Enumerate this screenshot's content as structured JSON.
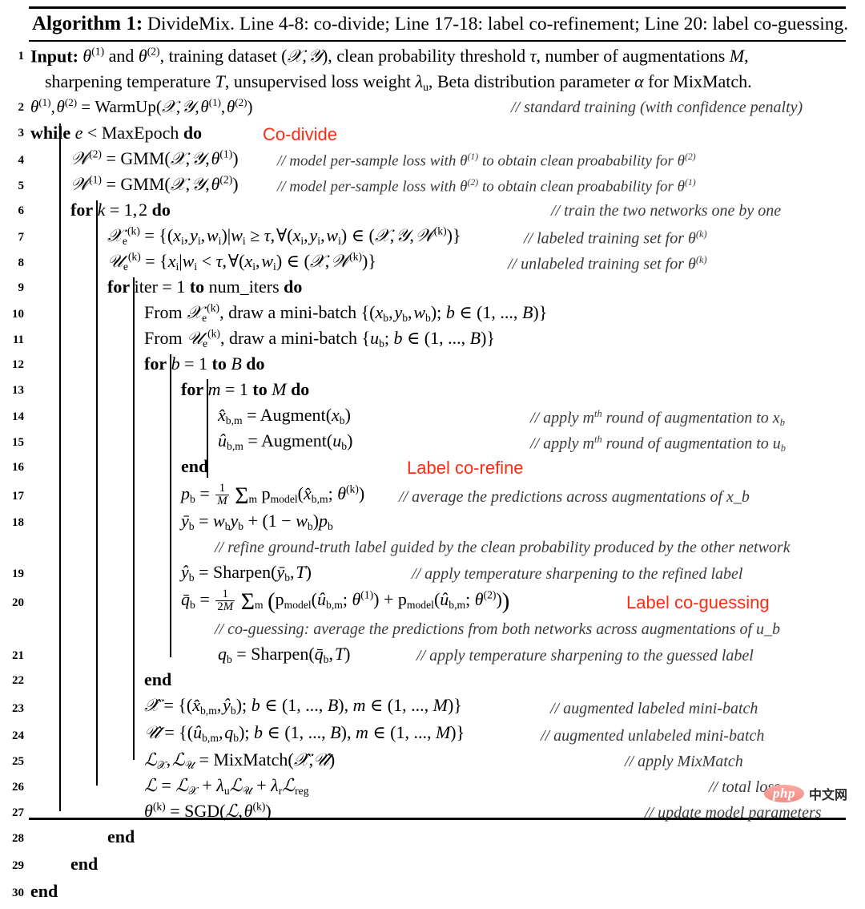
{
  "caption": {
    "label": "Algorithm 1:",
    "text": "DivideMix. Line 4-8: co-divide; Line 17-18: label co-refinement; Line 20: label co-guessing."
  },
  "annotations": {
    "co_divide": "Co-divide",
    "label_co_refine": "Label co-refine",
    "label_co_guessing": "Label co-guessing",
    "color": "#ff2b14"
  },
  "watermark": {
    "php": "php",
    "cn": "中文网"
  },
  "line_numbers": {
    "n1": "1",
    "n2": "2",
    "n3": "3",
    "n4": "4",
    "n5": "5",
    "n6": "6",
    "n7": "7",
    "n8": "8",
    "n9": "9",
    "n10": "10",
    "n11": "11",
    "n12": "12",
    "n13": "13",
    "n14": "14",
    "n15": "15",
    "n16": "16",
    "n17": "17",
    "n18": "18",
    "n19": "19",
    "n20": "20",
    "n21": "21",
    "n22": "22",
    "n23": "23",
    "n24": "24",
    "n25": "25",
    "n26": "26",
    "n27": "27",
    "n28": "28",
    "n29": "29",
    "n30": "30"
  },
  "comments": {
    "c2": "// standard training (with confidence penalty)",
    "c4": "// model per-sample loss with θ⁽¹⁾ to obtain clean proabability for θ⁽²⁾",
    "c5": "// model per-sample loss with θ⁽²⁾ to obtain clean proabability for θ⁽¹⁾",
    "c6": "// train the two networks one by one",
    "c7": "// labeled training set for θ⁽ᵏ⁾",
    "c8": "// unlabeled training set for θ⁽ᵏ⁾",
    "c14": "// apply mᵗʰ round of augmentation to x_b",
    "c15": "// apply mᵗʰ round of augmentation to u_b",
    "c17": "// average the predictions across augmentations of x_b",
    "c18": "// refine ground-truth label guided by the clean probability produced by the other network",
    "c19": "// apply temperature sharpening to the refined label",
    "c20": "// co-guessing: average the predictions from both networks across augmentations of u_b",
    "c21": "// apply temperature sharpening to the guessed label",
    "c23": "// augmented labeled mini-batch",
    "c24": "// augmented unlabeled mini-batch",
    "c25": "// apply MixMatch",
    "c26": "// total loss",
    "c27": "// update model parameters"
  },
  "keywords": {
    "input": "Input:",
    "while": "while",
    "for": "for",
    "to": "to",
    "do": "do",
    "end": "end"
  },
  "steps": {
    "s1a_pre": "Input:",
    "s1a": "θ(1) and θ(2), training dataset (X, Y), clean probability threshold τ, number of augmentations M,",
    "s1b": "sharpening temperature T, unsupervised loss weight λu, Beta distribution parameter α for MixMatch.",
    "s2": "θ(1), θ(2) = WarmUp(X, Y, θ(1), θ(2))",
    "s3": "while e < MaxEpoch do",
    "s4": "W(2) = GMM(X, Y, θ(1))",
    "s5": "W(1) = GMM(X, Y, θ(2))",
    "s6": "for k = 1, 2 do",
    "s7": "Xe(k) = {(xi, yi, wi)|wi ≥ τ, ∀(xi, yi, wi) ∈ (X, Y, W(k))}",
    "s8": "Ue(k) = {xi|wi < τ, ∀(xi, wi) ∈ (X, W(k))}",
    "s9": "for iter = 1 to num_iters do",
    "s10": "From Xe(k), draw a mini-batch {(xb, yb, wb); b ∈ (1, ..., B)}",
    "s11": "From Ue(k), draw a mini-batch {ub; b ∈ (1, ..., B)}",
    "s12": "for b = 1 to B do",
    "s13": "for m = 1 to M do",
    "s14": "x̂b,m = Augment(xb)",
    "s15": "ûb,m = Augment(ub)",
    "s16": "end",
    "s17": "pb = (1/M) Σm pmodel(x̂b,m; θ(k))",
    "s18": "ȳb = wb yb + (1 − wb) pb",
    "s19": "ŷb = Sharpen(ȳb, T)",
    "s20": "q̄b = (1/2M) Σm (pmodel(ûb,m; θ(1)) + pmodel(ûb,m; θ(2)))",
    "s21": "qb = Sharpen(q̄b, T)",
    "s22": "end",
    "s23": "X̂ = {(x̂b,m, ŷb); b ∈ (1, ..., B), m ∈ (1, ..., M)}",
    "s24": "Û = {(ûb,m, qb); b ∈ (1, ..., B), m ∈ (1, ..., M)}",
    "s25": "LX, LU = MixMatch(X̂, Û)",
    "s26": "L = LX + λu LU + λr Lreg",
    "s27": "θ(k) = SGD(L, θ(k))",
    "s28": "end",
    "s29": "end",
    "s30": "end"
  }
}
